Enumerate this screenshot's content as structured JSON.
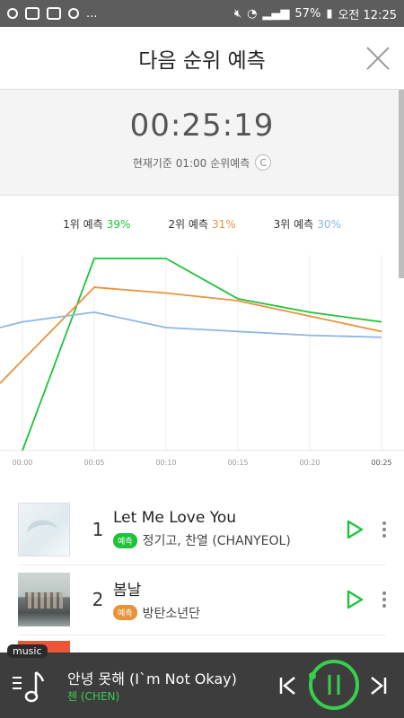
{
  "statusbar": {
    "left_icons": [
      "app-icon",
      "talk-icon",
      "talk-icon",
      "circle-icon"
    ],
    "ellipsis": "...",
    "battery": "57%",
    "time": "오전 12:25"
  },
  "header": {
    "title": "다음 순위 예측"
  },
  "timer": {
    "value": "00:25:19",
    "caption": "현재기준 01:00 순위예측",
    "refresh_glyph": "C"
  },
  "legend": [
    {
      "label": "1위 예측",
      "percent": "39%",
      "color": "#1fc33a"
    },
    {
      "label": "2위 예측",
      "percent": "31%",
      "color": "#e8933c"
    },
    {
      "label": "3위 예측",
      "percent": "30%",
      "color": "#8fb6e0"
    }
  ],
  "chart_data": {
    "type": "line",
    "x": [
      "00:00",
      "00:05",
      "00:10",
      "00:15",
      "00:20",
      "00:25"
    ],
    "series": [
      {
        "name": "1위 예측",
        "color": "#1fc33a",
        "values": [
          0,
          1.0,
          1.0,
          0.79,
          0.72,
          0.67
        ]
      },
      {
        "name": "2위 예측",
        "color": "#e8933c",
        "values": [
          0.47,
          0.85,
          0.82,
          0.78,
          0.7,
          0.62
        ]
      },
      {
        "name": "3위 예측",
        "color": "#8fb6e0",
        "values": [
          0.67,
          0.72,
          0.64,
          0.62,
          0.6,
          0.59
        ]
      }
    ],
    "ylim": [
      0,
      1
    ]
  },
  "rows": [
    {
      "rank": "1",
      "song": "Let Me Love You",
      "badge": "예측",
      "badge_color": "#1fc33a",
      "artist": "정기고, 찬열 (CHANYEOL)"
    },
    {
      "rank": "2",
      "song": "봄날",
      "badge": "예측",
      "badge_color": "#e8933c",
      "artist": "방탄소년단"
    }
  ],
  "player": {
    "tag": "music",
    "title": "안녕 못해 (I`m Not Okay)",
    "artist": "첸 (CHEN)",
    "accent": "#37d04d"
  }
}
